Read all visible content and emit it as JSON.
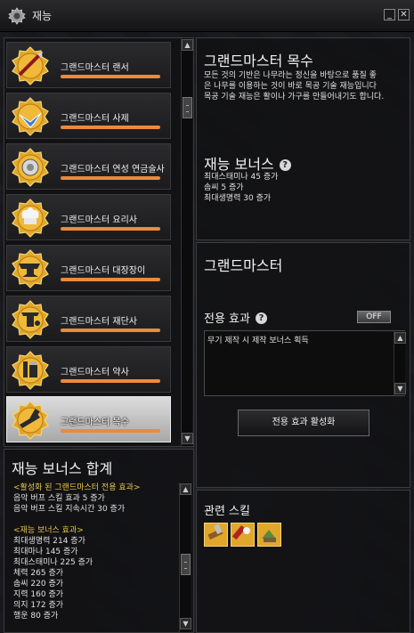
{
  "window": {
    "title": "재능",
    "minimize_label": "_",
    "close_label": "✕"
  },
  "talents": [
    {
      "label": "그랜드마스터 랜서",
      "icon": "lance-icon",
      "progress": 1.0
    },
    {
      "label": "그랜드마스터 사제",
      "icon": "dove-icon",
      "progress": 1.0
    },
    {
      "label": "그랜드마스터 연성 연금술사",
      "icon": "alchemy-icon",
      "progress": 1.0
    },
    {
      "label": "그랜드마스터 요리사",
      "icon": "chef-hat-icon",
      "progress": 1.0
    },
    {
      "label": "그랜드마스터 대장장이",
      "icon": "anvil-icon",
      "progress": 1.0
    },
    {
      "label": "그랜드마스터 재단사",
      "icon": "tailor-icon",
      "progress": 1.0
    },
    {
      "label": "그랜드마스터 약사",
      "icon": "potion-icon",
      "progress": 1.0
    },
    {
      "label": "그랜드마스터 목수",
      "icon": "carpenter-icon",
      "progress": 1.0,
      "selected": true
    }
  ],
  "bonus_summary": {
    "title": "재능 보너스 합계",
    "lines": [
      {
        "text": "<활성화 된 그랜드마스터 전용 효과>",
        "gold": true
      },
      {
        "text": "음악 버프 스킬 효과 5 증가",
        "gold": false
      },
      {
        "text": "음악 버프 스킬 지속시간 30 증가",
        "gold": false
      },
      {
        "text": "",
        "gold": false
      },
      {
        "text": "<재능 보너스 효과>",
        "gold": true
      },
      {
        "text": "최대생명력 214 증가",
        "gold": false
      },
      {
        "text": "최대마나 145 증가",
        "gold": false
      },
      {
        "text": "최대스태미나 225 증가",
        "gold": false
      },
      {
        "text": "체력 265 증가",
        "gold": false
      },
      {
        "text": "솜씨 220 증가",
        "gold": false
      },
      {
        "text": "지력 160 증가",
        "gold": false
      },
      {
        "text": "의지 172 증가",
        "gold": false
      },
      {
        "text": "행운 80 증가",
        "gold": false
      }
    ]
  },
  "detail": {
    "title": "그랜드마스터 목수",
    "description_lines": [
      "모든 것의 기반은 나무라는 정신을 바탕으로 품질 좋",
      "은 나무를 이용하는 것이 바로 목공 기술 재능입니다",
      "목공 기술 재능은 활이나 가구를 만들어내기도 합니다."
    ],
    "bonus_title": "재능 보너스",
    "bonus_lines": [
      "최대스태미나 45 증가",
      "솜씨 5 증가",
      "최대생명력 30 증가"
    ]
  },
  "effect": {
    "title": "그랜드마스터",
    "exclusive_label": "전용 효과",
    "toggle_label": "OFF",
    "effect_text": "무기 제작 시 제작 보너스 획득",
    "activate_button": "전용 효과 활성화"
  },
  "related": {
    "title": "관련 스킬",
    "skills": [
      "carpentry-skill-icon",
      "handicraft-skill-icon",
      "refining-skill-icon"
    ]
  },
  "colors": {
    "accent_bar": "#ec8a3c",
    "gold_text": "#e8c64a",
    "icon_gold": "#e0a72a"
  }
}
